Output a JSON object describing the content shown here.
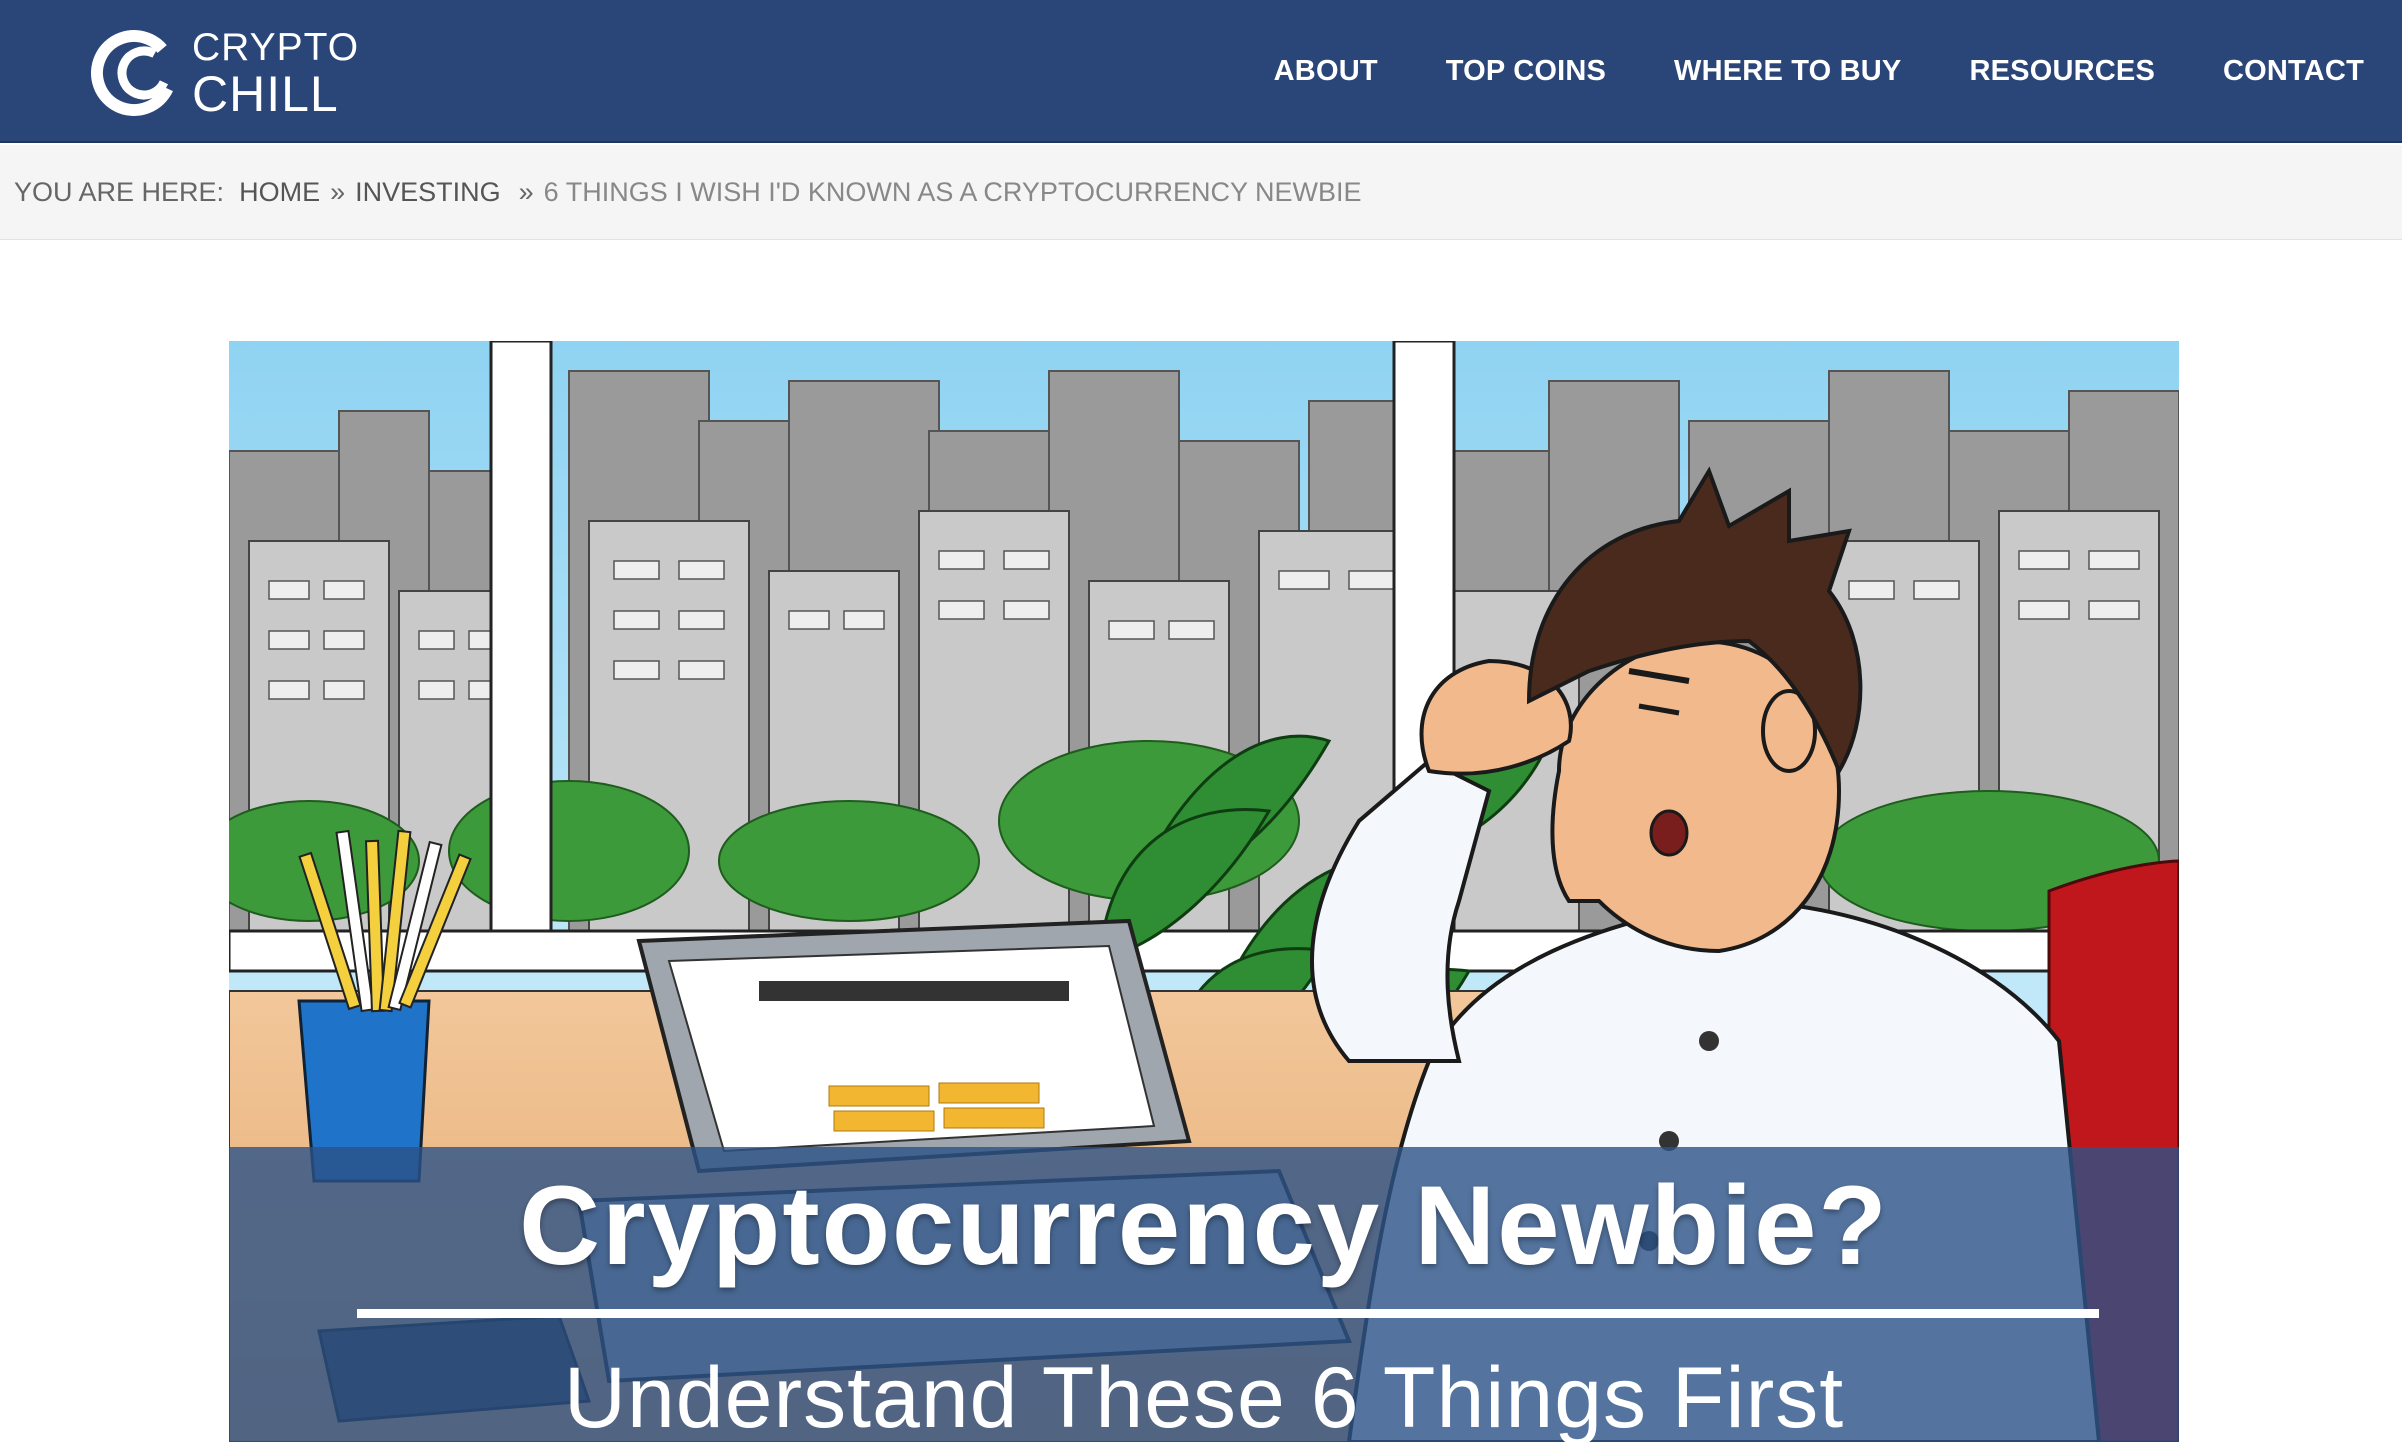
{
  "site": {
    "logo_line1": "CRYPTO",
    "logo_line2": "CHILL"
  },
  "nav": {
    "items": [
      {
        "label": "ABOUT"
      },
      {
        "label": "TOP COINS"
      },
      {
        "label": "WHERE TO BUY"
      },
      {
        "label": "RESOURCES"
      },
      {
        "label": "CONTACT"
      }
    ]
  },
  "breadcrumb": {
    "prefix": "YOU ARE HERE:",
    "home": "HOME",
    "separator": "»",
    "category": "INVESTING",
    "current": "6 THINGS I WISH I'D KNOWN AS A CRYPTOCURRENCY NEWBIE"
  },
  "hero": {
    "title": "Cryptocurrency Newbie?",
    "subtitle": "Understand These 6 Things First"
  },
  "colors": {
    "header_bg": "#2a4679",
    "breadcrumb_bg": "#f5f5f5",
    "banner_overlay": "#2c5287"
  }
}
